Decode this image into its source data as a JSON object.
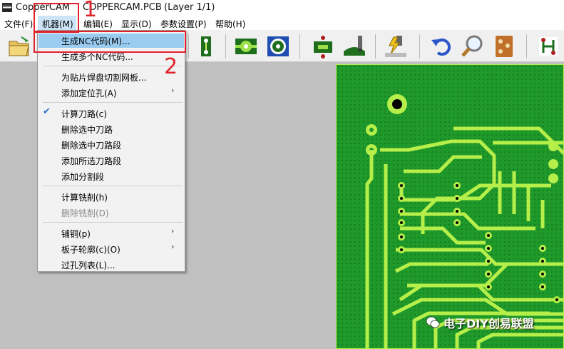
{
  "window": {
    "app_name": "CopperCAM",
    "file_name": "COPPERCAM.PCB",
    "layer": "(Layer 1/1)"
  },
  "menubar": {
    "items": [
      "文件(F)",
      "机器(M)",
      "编辑(E)",
      "显示(D)",
      "参数设置(P)",
      "帮助(H)"
    ],
    "active": "机器(M)"
  },
  "dropdown": {
    "items": [
      {
        "label": "生成NC代码(M)...",
        "highlighted": true
      },
      {
        "label": "生成多个NC代码..."
      },
      {
        "label": "为贴片焊盘切割网板..."
      },
      {
        "label": "添加定位孔(A)",
        "submenu": true
      },
      {
        "label": "计算刀路(c)",
        "checked": true
      },
      {
        "label": "删除选中刀路"
      },
      {
        "label": "删除选中刀路段"
      },
      {
        "label": "添加所选刀路段"
      },
      {
        "label": "添加分割段"
      },
      {
        "label": "计算铣削(h)"
      },
      {
        "label": "删除铣削(D)",
        "disabled": true
      },
      {
        "label": "铺铜(p)",
        "submenu": true
      },
      {
        "label": "板子轮廓(c)(O)",
        "submenu": true
      },
      {
        "label": "过孔列表(L)..."
      }
    ],
    "submenu_glyph": "›",
    "check_glyph": "✔"
  },
  "toolbar": {
    "icons": [
      "open-folder-icon",
      "pcb-layer-icon",
      "pad-icon",
      "pad-ring-icon",
      "drill-icon",
      "milling-tool-icon",
      "lightning-tool-icon",
      "undo-icon",
      "zoom-icon",
      "board-icon",
      "track-icon"
    ]
  },
  "annotations": {
    "label_1": "1",
    "label_2": "2",
    "color": "#e0232b"
  },
  "watermark": {
    "text": "电子DIY创易联盟"
  },
  "colors": {
    "pcb_green": "#1f9a2a",
    "trace_light": "#b6ef4a",
    "menu_highlight": "#99ccf0"
  }
}
